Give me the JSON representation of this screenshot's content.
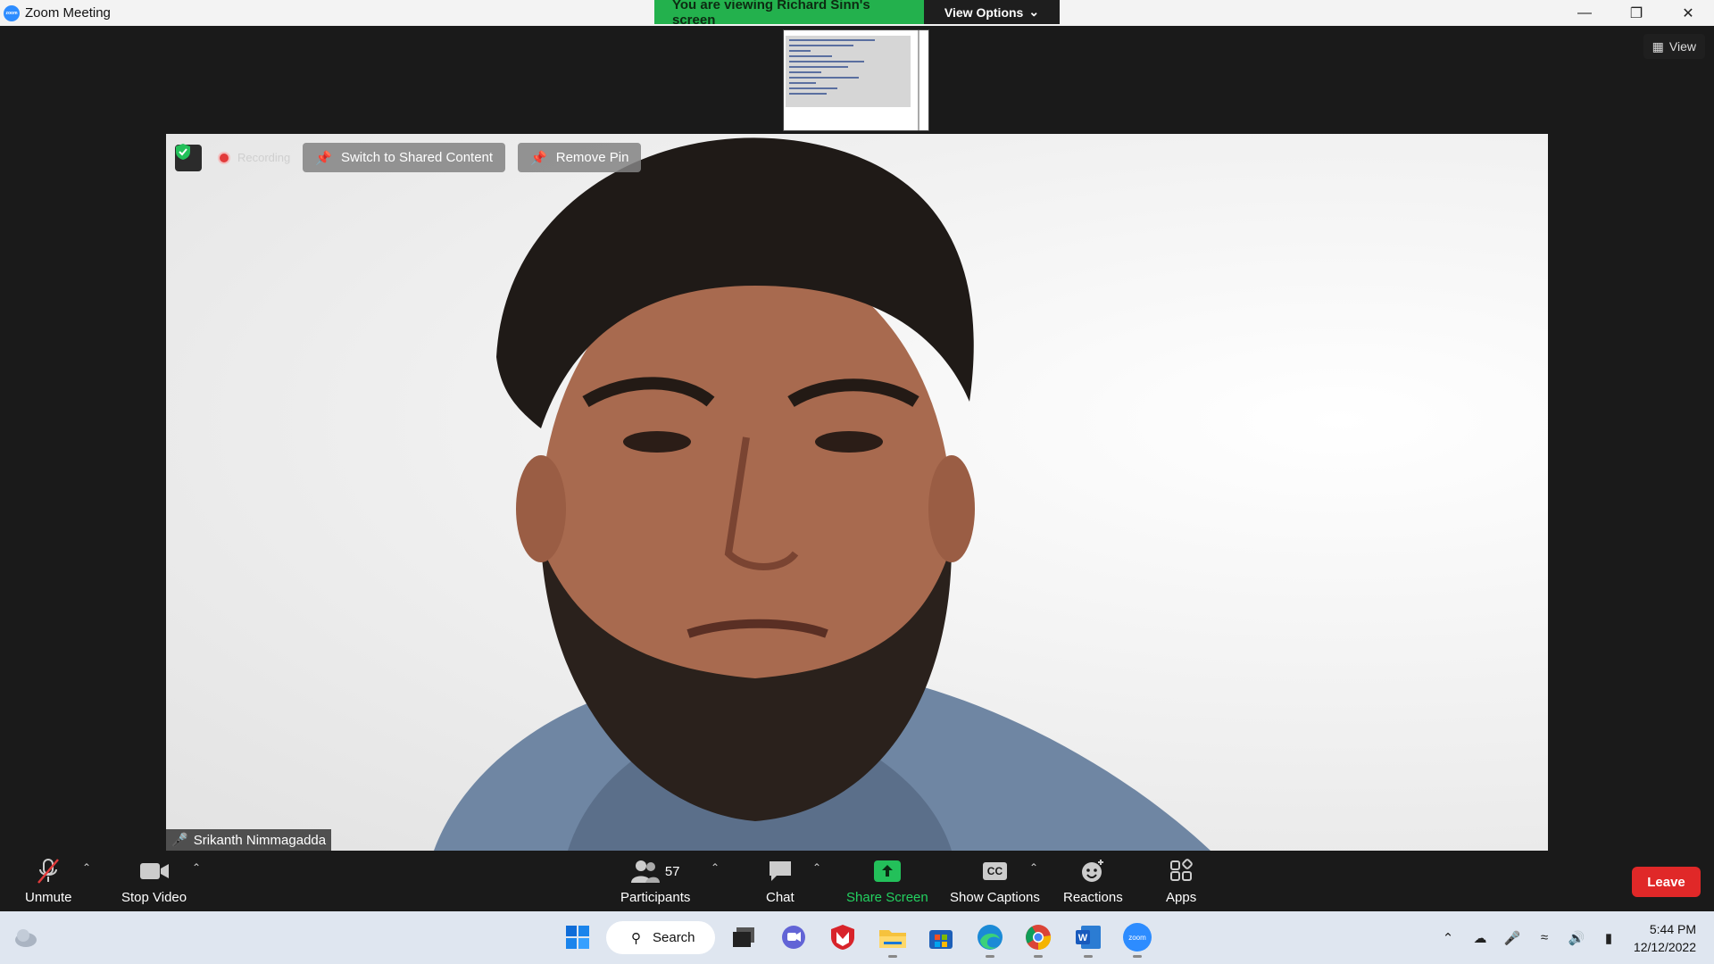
{
  "window": {
    "title": "Zoom Meeting"
  },
  "banner": {
    "message": "You are viewing Richard Sinn's screen",
    "view_options": "View Options"
  },
  "view_button": {
    "label": "View"
  },
  "video_toolbar": {
    "recording": "Recording",
    "switch_shared": "Switch to Shared Content",
    "remove_pin": "Remove Pin"
  },
  "participant": {
    "name": "Srikanth Nimmagadda"
  },
  "controls": {
    "unmute": "Unmute",
    "stop_video": "Stop Video",
    "participants_count": "57",
    "participants": "Participants",
    "chat": "Chat",
    "share_screen": "Share Screen",
    "show_captions": "Show Captions",
    "cc_badge": "CC",
    "reactions": "Reactions",
    "apps": "Apps",
    "leave": "Leave"
  },
  "taskbar": {
    "search": "Search",
    "time": "5:44 PM",
    "date": "12/12/2022",
    "zoom_badge": "zoom"
  },
  "colors": {
    "share_green": "#23d160",
    "banner_green": "#23b14d",
    "leave_red": "#e02828"
  }
}
